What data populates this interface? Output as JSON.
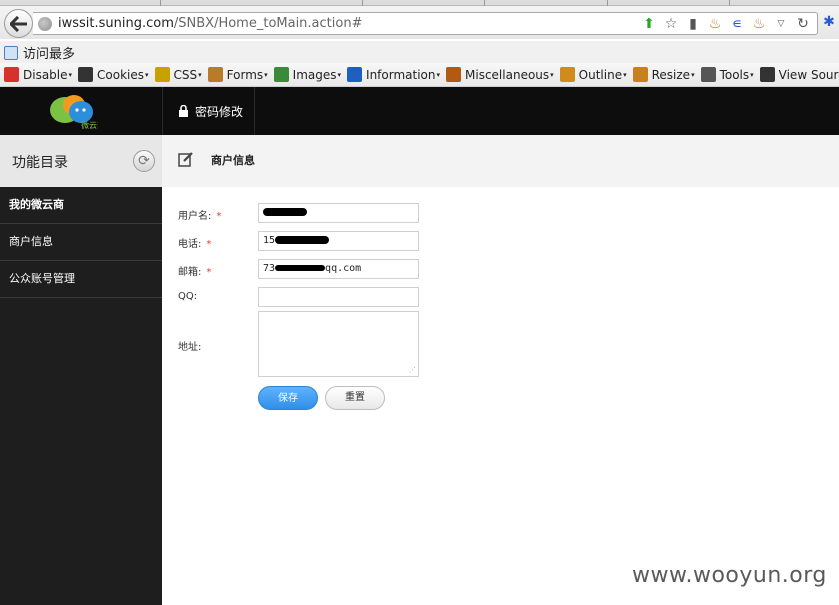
{
  "browser": {
    "url_host": "iwssit.suning.com",
    "url_path": "/SNBX/Home_toMain.action#",
    "bookmark_label": "访问最多",
    "toolbar_items": [
      {
        "label": "Disable",
        "icon": "no-entry-icon",
        "color": "#d9302c"
      },
      {
        "label": "Cookies",
        "icon": "person-icon",
        "color": "#333333"
      },
      {
        "label": "CSS",
        "icon": "wand-icon",
        "color": "#c8a000"
      },
      {
        "label": "Forms",
        "icon": "clipboard-icon",
        "color": "#b97a2a"
      },
      {
        "label": "Images",
        "icon": "picture-icon",
        "color": "#3a8a3a"
      },
      {
        "label": "Information",
        "icon": "info-icon",
        "color": "#1f5fbf"
      },
      {
        "label": "Miscellaneous",
        "icon": "book-icon",
        "color": "#b25a12"
      },
      {
        "label": "Outline",
        "icon": "pencil-icon",
        "color": "#d28b1a"
      },
      {
        "label": "Resize",
        "icon": "ruler-icon",
        "color": "#c9801e"
      },
      {
        "label": "Tools",
        "icon": "wrench-icon",
        "color": "#555555"
      },
      {
        "label": "View Source",
        "icon": "monitor-icon",
        "color": "#333333"
      }
    ]
  },
  "header": {
    "logo_text": "微云商",
    "password_label": "密码修改"
  },
  "sidebar": {
    "title": "功能目录",
    "items": [
      {
        "label": "我的微云商"
      },
      {
        "label": "商户信息"
      },
      {
        "label": "公众账号管理"
      }
    ]
  },
  "main": {
    "title": "商户信息",
    "form": {
      "username_label": "用户名:",
      "phone_label": "电话:",
      "phone_value_visible": "15",
      "email_label": "邮箱:",
      "email_prefix_visible": "73",
      "email_suffix_visible": "qq.com",
      "qq_label": "QQ:",
      "address_label": "地址:",
      "required_mark": "*",
      "save_label": "保存",
      "reset_label": "重置"
    }
  },
  "watermark": "www.wooyun.org",
  "colors": {
    "accent": "#3a95f0",
    "required": "#e33333",
    "header_bg": "#0d0d0d",
    "sidebar_bg": "#1e1e1e"
  }
}
